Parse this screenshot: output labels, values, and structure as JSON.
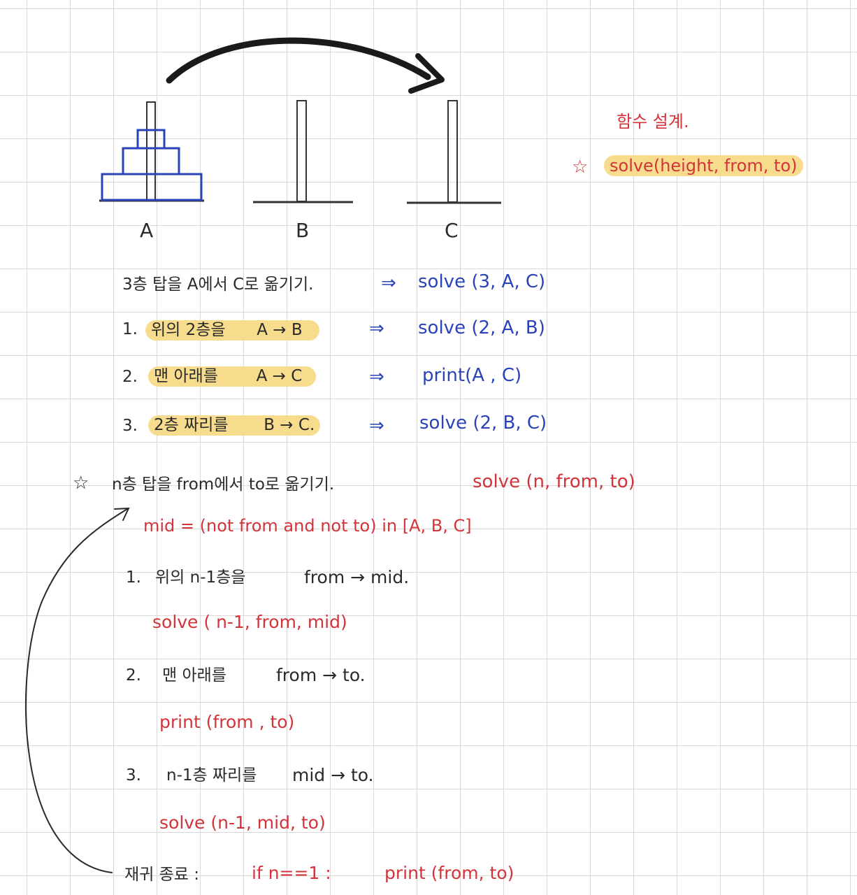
{
  "colors": {
    "ink": "#2a2a2a",
    "blue": "#2a43b8",
    "red": "#d2343a",
    "highlight": "#f8dc8e",
    "grid": "#d9d9d9"
  },
  "pegs": {
    "a": "A",
    "b": "B",
    "c": "C"
  },
  "design": {
    "title": "함수 설계.",
    "star": "☆",
    "signature": "solve(height, from, to)"
  },
  "example": {
    "goal": "3층 탑을 A에서 C로 옮기기.",
    "goal_arrow": "⇒",
    "goal_call": "solve (3, A, C)",
    "steps": [
      {
        "num": "1.",
        "text": "위의 2층을",
        "move": "A → B",
        "arrow": "⇒",
        "call": "solve (2, A, B)"
      },
      {
        "num": "2.",
        "text": "맨 아래를",
        "move": "A → C",
        "arrow": "⇒",
        "call": "print(A , C)"
      },
      {
        "num": "3.",
        "text": "2층 짜리를",
        "move": "B → C.",
        "arrow": "⇒",
        "call": "solve (2, B, C)"
      }
    ]
  },
  "general": {
    "star": "☆",
    "goal": "n층 탑을 from에서 to로 옮기기.",
    "call": "solve (n, from, to)",
    "mid": "mid =  (not from and not to)  in  [A, B, C]",
    "steps": [
      {
        "num": "1.",
        "text": "위의 n-1층을",
        "move": "from → mid.",
        "code": "solve ( n-1, from, mid)"
      },
      {
        "num": "2.",
        "text": "맨 아래를",
        "move": "from → to.",
        "code": "print (from , to)"
      },
      {
        "num": "3.",
        "text": "n-1층 짜리를",
        "move": "mid → to.",
        "code": "solve (n-1, mid, to)"
      }
    ],
    "base_label": "재귀 종료 :",
    "base_cond": "if  n==1 :",
    "base_code": "print (from, to)"
  }
}
